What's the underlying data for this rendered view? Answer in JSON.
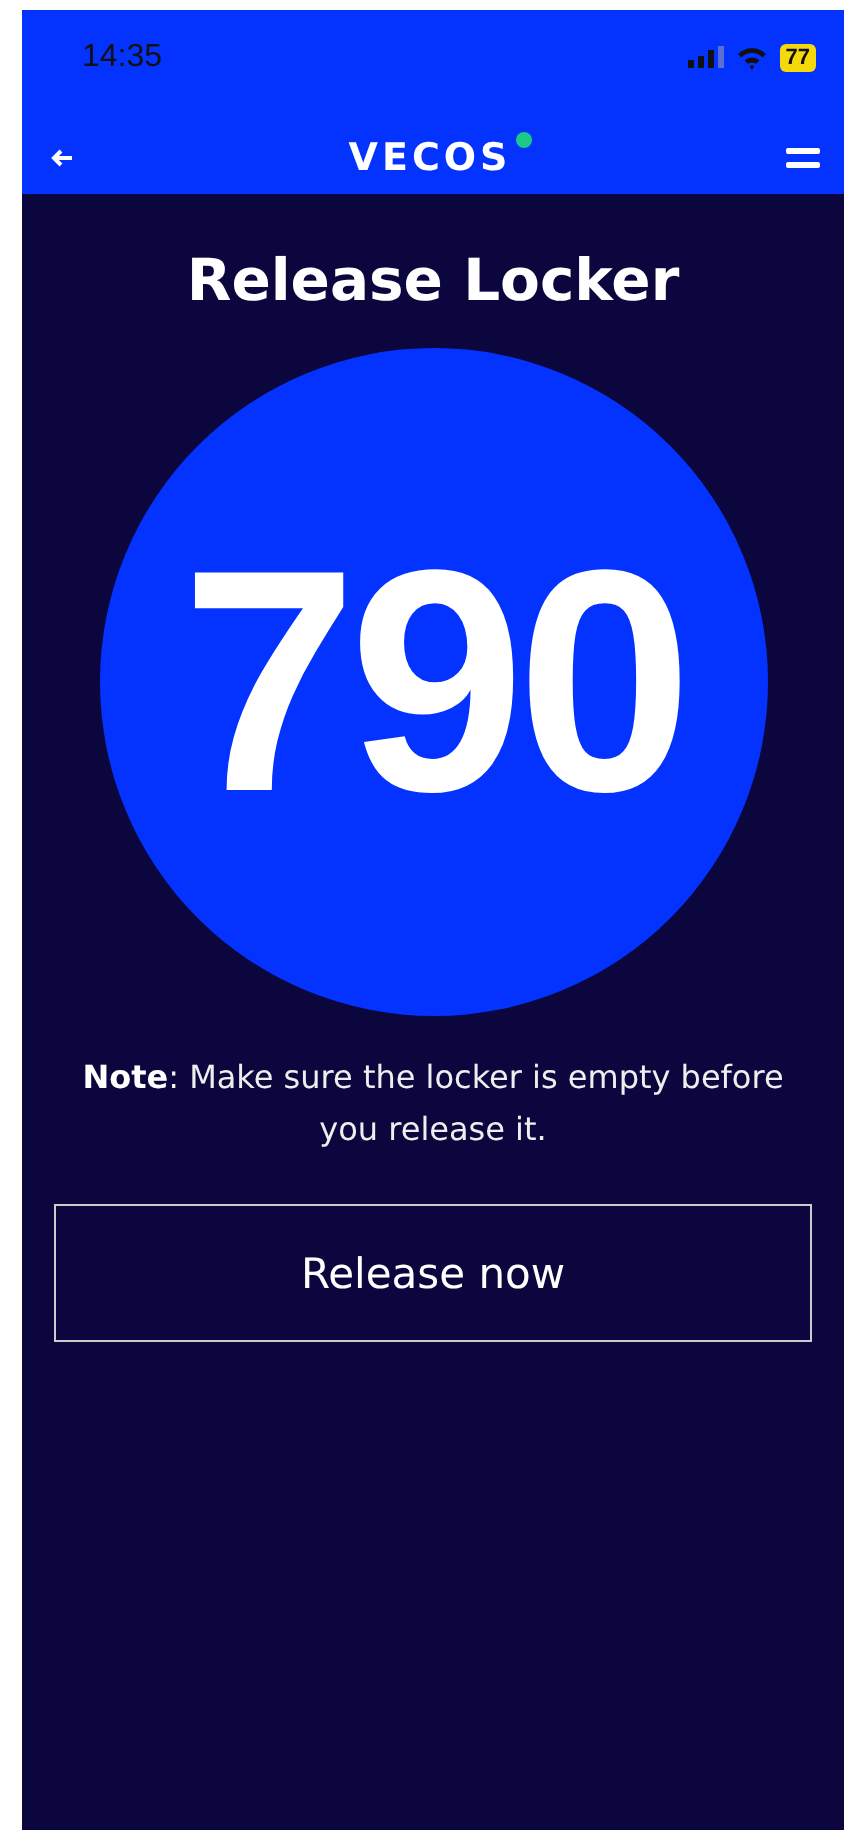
{
  "status_bar": {
    "time": "14:35",
    "battery": "77"
  },
  "nav": {
    "brand": "VECOS"
  },
  "title": "Release Locker",
  "locker_number": "790",
  "note": "**Note**: Make sure the locker is empty before you release it.",
  "button": "Release now"
}
